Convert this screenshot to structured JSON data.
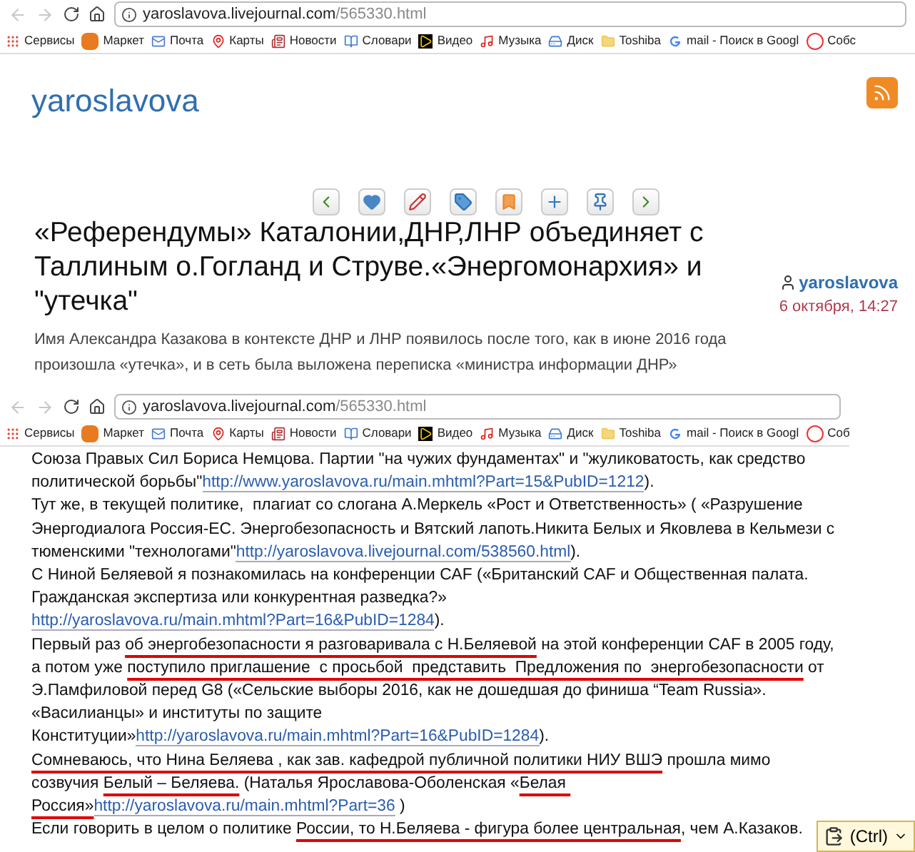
{
  "browsers": [
    {
      "url_host": "yaroslavova.livejournal.com",
      "url_path": "/565330.html",
      "bookmarks": [
        "Сервисы",
        "Маркет",
        "Почта",
        "Карты",
        "Новости",
        "Словари",
        "Видео",
        "Музыка",
        "Диск",
        "Toshiba",
        "mail - Поиск в Googl",
        "Собс"
      ]
    },
    {
      "url_host": "yaroslavova.livejournal.com",
      "url_path": "/565330.html",
      "bookmarks": [
        "Сервисы",
        "Маркет",
        "Почта",
        "Карты",
        "Новости",
        "Словари",
        "Видео",
        "Музыка",
        "Диск",
        "Toshiba",
        "mail - Поиск в Googl",
        "Соб"
      ]
    }
  ],
  "blog": {
    "name": "yaroslavova"
  },
  "post": {
    "title": "«Референдумы» Каталонии,ДНР,ЛНР объединяет с Таллиным о.Гогланд и Струве.«Энергомонархия» и \"утечка\"",
    "author": "yaroslavova",
    "date": "6 октября, 14:27",
    "summary": "Имя Александра Казакова в контексте ДНР и ЛНР появилось после того, как в июне 2016 года произошла «утечка», и в сеть была выложена переписка «министра информации ДНР»"
  },
  "article": [
    [
      {
        "kind": "text",
        "text": "Союза Правых Сил Бориса Немцова. Партии \"на чужих фундаментах\" и \"жуликоватость, как средство политической борьбы\""
      },
      {
        "kind": "link",
        "text": "http://www.yaroslavova.ru/main.mhtml?Part=15&PubID=1212"
      },
      {
        "kind": "text",
        "text": ")."
      }
    ],
    [
      {
        "kind": "text",
        "text": "Тут же, в текущей политике,  плагиат со слогана А.Меркель «Рост и Ответственность» ( «Разрушение Энергодиалога Россия-ЕС. Энергобезопасность и Вятский лапоть.Никита Белых и Яковлева в Кельмези с тюменскими \"технологами\""
      },
      {
        "kind": "link",
        "text": "http://yaroslavova.livejournal.com/538560.html"
      },
      {
        "kind": "text",
        "text": ")."
      }
    ],
    [
      {
        "kind": "text",
        "text": "С Ниной Беляевой я познакомилась на конференции CAF («Британский CAF и Общественная палата. Гражданская экспертиза или конкурентная разведка?» "
      },
      {
        "kind": "link",
        "text": "http://yaroslavova.ru/main.mhtml?Part=16&PubID=1284"
      },
      {
        "kind": "text",
        "text": ")."
      }
    ],
    [
      {
        "kind": "text",
        "text": "Первый раз "
      },
      {
        "kind": "marked",
        "text": "об энергобезопасности я разговаривала с Н.Беляевой"
      },
      {
        "kind": "text",
        "text": " на этой конференции CAF в 2005 году, а потом уже "
      },
      {
        "kind": "marked",
        "text": "поступило приглашение  с просьбой  представить  Предложения по  энергобезопасности"
      },
      {
        "kind": "text",
        "text": " от Э.Памфиловой перед G8 («Сельские выборы 2016, как не дошедшая до финиша “Team Russia». «Василианцы» и институты по защите Конституции»"
      },
      {
        "kind": "link",
        "text": "http://yaroslavova.ru/main.mhtml?Part=16&PubID=1284"
      },
      {
        "kind": "text",
        "text": ")."
      }
    ],
    [
      {
        "kind": "marked",
        "text": "Сомневаюсь, что Нина Беляева , как зав. кафедрой публичной политики НИУ ВШЭ"
      },
      {
        "kind": "text",
        "text": " прошла мимо созвучия "
      },
      {
        "kind": "marked",
        "text": "Белый – Беляева."
      },
      {
        "kind": "text",
        "text": " (Наталья Ярославова-Оболенская «"
      },
      {
        "kind": "marked",
        "text": "Белая Россия»"
      },
      {
        "kind": "link",
        "text": "http://yaroslavova.ru/main.mhtml?Part=36"
      },
      {
        "kind": "text",
        "text": " )"
      }
    ],
    [
      {
        "kind": "text",
        "text": "Если говорить в целом о политике "
      },
      {
        "kind": "marked",
        "text": "России, то Н.Беляева - фигура более центральная"
      },
      {
        "kind": "text",
        "text": ", чем А.Казаков."
      }
    ]
  ],
  "paste_button": {
    "label": "(Ctrl)"
  }
}
